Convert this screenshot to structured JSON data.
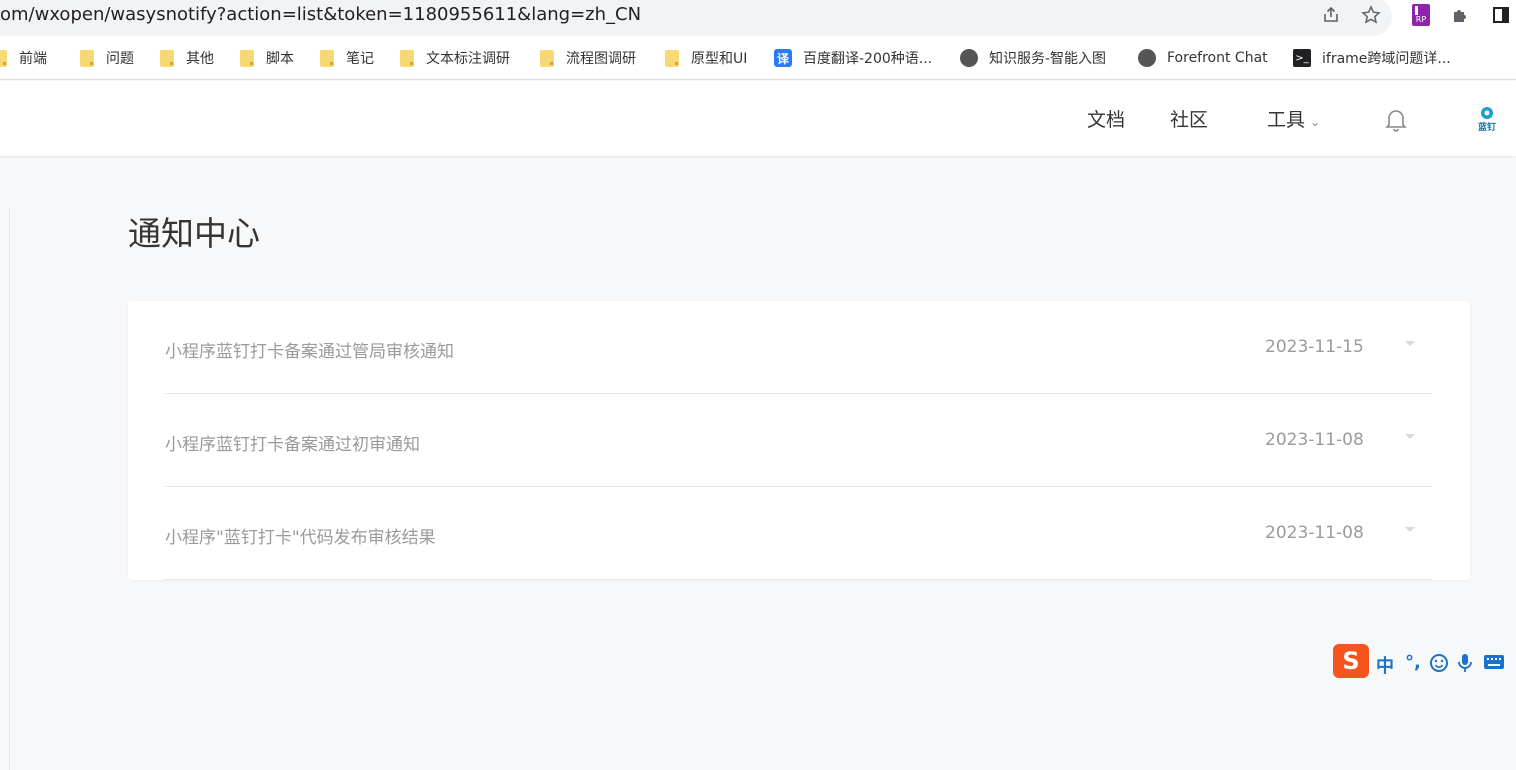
{
  "browser": {
    "url": "om/wxopen/wasysnotify?action=list&token=1180955611&lang=zh_CN",
    "bookmarks": [
      {
        "label": "前端",
        "icon": "folder-icon"
      },
      {
        "label": "问题",
        "icon": "folder-icon"
      },
      {
        "label": "其他",
        "icon": "folder-icon"
      },
      {
        "label": "脚本",
        "icon": "folder-icon"
      },
      {
        "label": "笔记",
        "icon": "folder-icon"
      },
      {
        "label": "文本标注调研",
        "icon": "folder-icon"
      },
      {
        "label": "流程图调研",
        "icon": "folder-icon"
      },
      {
        "label": "原型和UI",
        "icon": "folder-icon"
      },
      {
        "label": "百度翻译-200种语...",
        "icon": "fanyi-icon",
        "glyph": "译"
      },
      {
        "label": "知识服务-智能入图",
        "icon": "globe-icon"
      },
      {
        "label": "Forefront Chat",
        "icon": "globe-icon"
      },
      {
        "label": "iframe跨域问题详...",
        "icon": "terminal-icon",
        "glyph": ">_"
      }
    ]
  },
  "header": {
    "nav_docs": "文档",
    "nav_community": "社区",
    "nav_tools": "工具",
    "logo_text": "蓝钉"
  },
  "main": {
    "title": "通知中心",
    "notifications": [
      {
        "title": "小程序蓝钉打卡备案通过管局审核通知",
        "date": "2023-11-15"
      },
      {
        "title": "小程序蓝钉打卡备案通过初审通知",
        "date": "2023-11-08"
      },
      {
        "title": "小程序\"蓝钉打卡\"代码发布审核结果",
        "date": "2023-11-08"
      }
    ]
  },
  "ime": {
    "logo": "S",
    "mode": "中",
    "punct": "°,"
  },
  "colors": {
    "ime_brand": "#f4541e",
    "ime_blue": "#1a73c8",
    "folder": "#f8d775",
    "fanyi": "#2a7bf7"
  }
}
